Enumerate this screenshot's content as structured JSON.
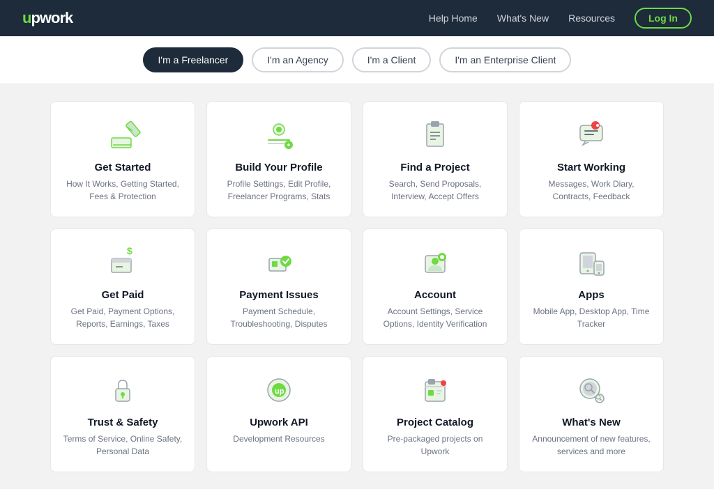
{
  "header": {
    "logo_text": "upwork",
    "nav": [
      {
        "label": "Help Home",
        "key": "help-home"
      },
      {
        "label": "What's New",
        "key": "whats-new"
      },
      {
        "label": "Resources",
        "key": "resources"
      }
    ],
    "login_label": "Log In"
  },
  "tabs": [
    {
      "label": "I'm a Freelancer",
      "key": "freelancer",
      "active": true
    },
    {
      "label": "I'm an Agency",
      "key": "agency",
      "active": false
    },
    {
      "label": "I'm a Client",
      "key": "client",
      "active": false
    },
    {
      "label": "I'm an Enterprise Client",
      "key": "enterprise",
      "active": false
    }
  ],
  "cards": [
    {
      "key": "get-started",
      "title": "Get Started",
      "desc": "How It Works, Getting Started, Fees & Protection",
      "icon": "pencil"
    },
    {
      "key": "build-profile",
      "title": "Build Your Profile",
      "desc": "Profile Settings, Edit Profile, Freelancer Programs, Stats",
      "icon": "profile"
    },
    {
      "key": "find-project",
      "title": "Find a Project",
      "desc": "Search, Send Proposals, Interview, Accept Offers",
      "icon": "clipboard"
    },
    {
      "key": "start-working",
      "title": "Start Working",
      "desc": "Messages, Work Diary, Contracts, Feedback",
      "icon": "chat"
    },
    {
      "key": "get-paid",
      "title": "Get Paid",
      "desc": "Get Paid, Payment Options, Reports, Earnings, Taxes",
      "icon": "dollar"
    },
    {
      "key": "payment-issues",
      "title": "Payment Issues",
      "desc": "Payment Schedule, Troubleshooting, Disputes",
      "icon": "payment"
    },
    {
      "key": "account",
      "title": "Account",
      "desc": "Account Settings, Service Options, Identity Verification",
      "icon": "account"
    },
    {
      "key": "apps",
      "title": "Apps",
      "desc": "Mobile App, Desktop App, Time Tracker",
      "icon": "mobile"
    },
    {
      "key": "trust-safety",
      "title": "Trust & Safety",
      "desc": "Terms of Service, Online Safety, Personal Data",
      "icon": "lock"
    },
    {
      "key": "upwork-api",
      "title": "Upwork API",
      "desc": "Development Resources",
      "icon": "api"
    },
    {
      "key": "project-catalog",
      "title": "Project Catalog",
      "desc": "Pre-packaged projects on Upwork",
      "icon": "catalog"
    },
    {
      "key": "whats-new",
      "title": "What's New",
      "desc": "Announcement of new features, services and more",
      "icon": "search-circle"
    }
  ]
}
